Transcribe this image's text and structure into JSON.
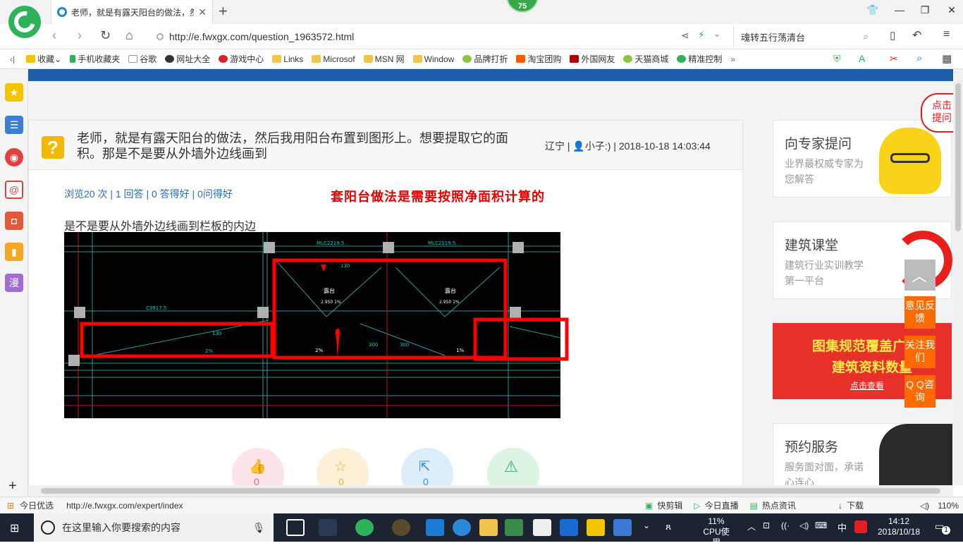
{
  "browser": {
    "tab_title": "老师，就是有露天阳台的做法，然",
    "badge_count": "75",
    "url": "http://e.fwxgx.com/question_1963572.html",
    "search_text": "魂转五行荡清台",
    "bookmarks": [
      "收藏",
      "手机收藏夹",
      "谷歌",
      "网址大全",
      "游戏中心",
      "Links",
      "Microsof",
      "MSN 网",
      "Window",
      "品牌打折",
      "淘宝团购",
      "外国网友",
      "天猫商城",
      "精准控制"
    ]
  },
  "question": {
    "title": "老师，就是有露天阳台的做法，然后我用阳台布置到图形上。想要提取它的面积。那是不是要从外墙外边线画到",
    "location": "辽宁",
    "author": "小子:)",
    "datetime": "2018-10-18 14:03:44",
    "stats": "浏览20 次 | 1 回答 | 0 答得好 | 0问得好",
    "annotation": "套阳台做法是需要按照净面积计算的",
    "body": "是不是要从外墙外边线画到栏板的内边",
    "action_counts": [
      "0",
      "0",
      "0"
    ]
  },
  "cad": {
    "labels": [
      "MLC2219.5",
      "MLC2219.5",
      "露台",
      "露台",
      "C3917.5",
      "2.950 1%",
      "2.950 1%",
      "1%",
      "2%",
      "2%",
      "300",
      "300",
      "130",
      "130"
    ]
  },
  "sidebar_right": {
    "ask": {
      "title": "向专家提问",
      "sub": "业界最权威专家为您解答",
      "corner": "点击提问"
    },
    "class": {
      "title": "建筑课堂",
      "sub": "建筑行业实训教学第一平台"
    },
    "banner": {
      "line1": "图集规范覆盖广",
      "line2": "建筑资料数量",
      "cta": "点击查看"
    },
    "service": {
      "title": "预约服务",
      "sub": "服务面对面，承诺心连心"
    },
    "float_buttons": [
      "意见反馈",
      "关注我们",
      "Q Q咨询"
    ]
  },
  "status": {
    "left": "今日优选",
    "url": "http://e.fwxgx.com/expert/index",
    "items": [
      "快剪辑",
      "今日直播",
      "热点资讯",
      "下载"
    ],
    "zoom": "110%"
  },
  "taskbar": {
    "search_placeholder": "在这里输入你要搜索的内容",
    "cpu_percent": "11%",
    "cpu_label": "CPU使用",
    "ime": "中",
    "time": "14:12",
    "date": "2018/10/18",
    "notifications": "1"
  },
  "colors": {
    "accent_blue": "#1f5fa8",
    "red": "#e60000",
    "orange": "#ff6a00",
    "green": "#2fb35a"
  }
}
